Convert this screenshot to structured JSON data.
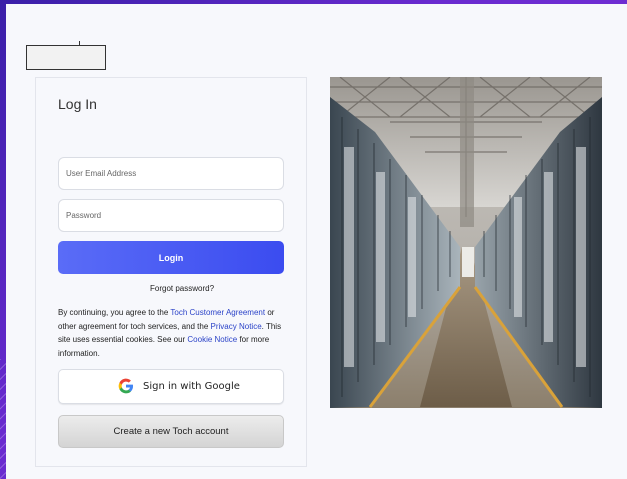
{
  "login": {
    "title": "Log In",
    "email_placeholder": "User Email Address",
    "password_placeholder": "Password",
    "login_label": "Login",
    "forgot_label": "Forgot password?"
  },
  "terms": {
    "text1": "By continuing, you agree to the ",
    "agreement_link": "Toch Customer Agreement",
    "text2": " or other agreement for toch services, and the ",
    "privacy_link": "Privacy Notice",
    "text3": ". This site uses essential cookies. See our ",
    "cookie_link": "Cookie Notice",
    "text4": " for more information."
  },
  "google": {
    "label": "Sign in with Google",
    "icon": "google-g-icon"
  },
  "create": {
    "label": "Create a new Toch account"
  },
  "colors": {
    "accent": "#3b4cf0",
    "link": "#2b43c8",
    "frame": "#6a2bd0"
  }
}
